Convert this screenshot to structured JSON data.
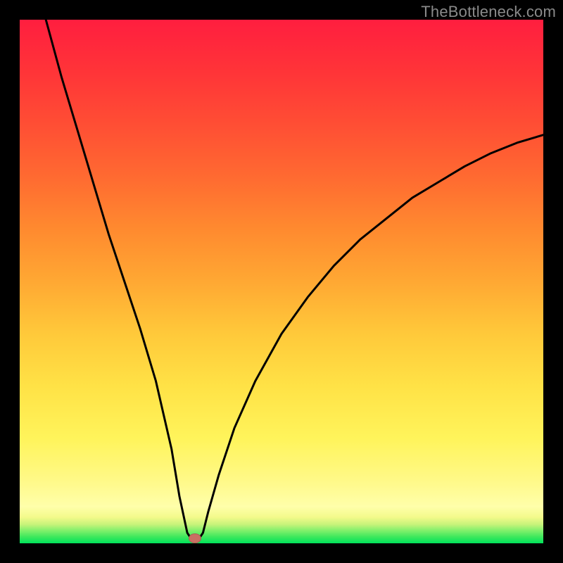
{
  "watermark": "TheBottleneck.com",
  "marker": {
    "color": "#c97063",
    "x_pct": 33.5,
    "y_pct": 99.0
  },
  "chart_data": {
    "type": "line",
    "title": "",
    "xlabel": "",
    "ylabel": "",
    "xlim": [
      0,
      100
    ],
    "ylim": [
      0,
      100
    ],
    "series": [
      {
        "name": "bottleneck-curve",
        "x": [
          5,
          8,
          11,
          14,
          17,
          20,
          23,
          26,
          29,
          30.5,
          32,
          33,
          34,
          35,
          36,
          38,
          41,
          45,
          50,
          55,
          60,
          65,
          70,
          75,
          80,
          85,
          90,
          95,
          100
        ],
        "y": [
          100,
          89,
          79,
          69,
          59,
          50,
          41,
          31,
          18,
          9,
          2,
          0.5,
          0.5,
          2,
          6,
          13,
          22,
          31,
          40,
          47,
          53,
          58,
          62,
          66,
          69,
          72,
          74.5,
          76.5,
          78
        ]
      }
    ],
    "annotations": [
      {
        "type": "marker",
        "x": 33.5,
        "y": 1,
        "color": "#c97063",
        "shape": "ellipse"
      }
    ],
    "background_gradient": {
      "direction": "vertical",
      "stops": [
        {
          "pos": 0.0,
          "color": "#00e35b"
        },
        {
          "pos": 0.05,
          "color": "#f3fa8b"
        },
        {
          "pos": 0.12,
          "color": "#fff988"
        },
        {
          "pos": 0.3,
          "color": "#ffe246"
        },
        {
          "pos": 0.5,
          "color": "#ffa833"
        },
        {
          "pos": 0.7,
          "color": "#ff6a31"
        },
        {
          "pos": 0.9,
          "color": "#ff3438"
        },
        {
          "pos": 1.0,
          "color": "#ff1e3f"
        }
      ]
    }
  }
}
